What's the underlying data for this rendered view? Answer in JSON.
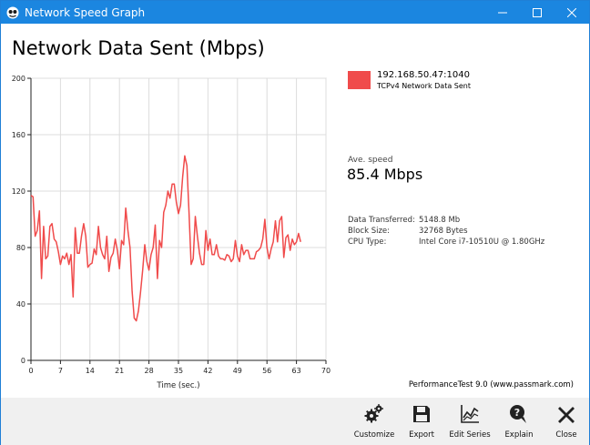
{
  "window": {
    "title": "Network Speed Graph"
  },
  "heading": "Network Data Sent (Mbps)",
  "legend": {
    "series_name": "192.168.50.47:1040",
    "description": "TCPv4 Network Data Sent",
    "color": "#f04b4b"
  },
  "average": {
    "label": "Ave. speed",
    "value": "85.4 Mbps"
  },
  "stats": [
    {
      "key": "Data Transferred:",
      "value": "5148.8 Mb"
    },
    {
      "key": "Block Size:",
      "value": "32768 Bytes"
    },
    {
      "key": "CPU Type:",
      "value": "Intel Core i7-10510U @ 1.80GHz"
    }
  ],
  "footer_note": "PerformanceTest 9.0 (www.passmark.com)",
  "toolbar": {
    "customize": "Customize",
    "export": "Export",
    "edit_series": "Edit Series",
    "explain": "Explain",
    "close": "Close"
  },
  "chart_data": {
    "type": "line",
    "xlabel": "Time (sec.)",
    "ylabel": "",
    "xlim": [
      0,
      70
    ],
    "ylim": [
      0,
      200
    ],
    "xticks": [
      0,
      7,
      14,
      21,
      28,
      35,
      42,
      49,
      56,
      63,
      70
    ],
    "yticks": [
      0,
      40,
      80,
      120,
      160,
      200
    ],
    "grid": true,
    "series": [
      {
        "name": "192.168.50.47:1040",
        "color": "#f04b4b",
        "x": [
          0,
          0.5,
          1,
          1.5,
          2,
          2.5,
          3,
          3.5,
          4,
          4.5,
          5,
          5.5,
          6,
          6.5,
          7,
          7.5,
          8,
          8.5,
          9,
          9.5,
          10,
          10.5,
          11,
          11.5,
          12,
          12.5,
          13,
          13.5,
          14,
          14.5,
          15,
          15.5,
          16,
          16.5,
          17,
          17.5,
          18,
          18.5,
          19,
          19.5,
          20,
          20.5,
          21,
          21.5,
          22,
          22.5,
          23,
          23.5,
          24,
          24.5,
          25,
          25.5,
          26,
          26.5,
          27,
          27.5,
          28,
          28.5,
          29,
          29.5,
          30,
          30.5,
          31,
          31.5,
          32,
          32.5,
          33,
          33.5,
          34,
          34.5,
          35,
          35.5,
          36,
          36.5,
          37,
          37.5,
          38,
          38.5,
          39,
          39.5,
          40,
          40.5,
          41,
          41.5,
          42,
          42.5,
          43,
          43.5,
          44,
          44.5,
          45,
          45.5,
          46,
          46.5,
          47,
          47.5,
          48,
          48.5,
          49,
          49.5,
          50,
          50.5,
          51,
          51.5,
          52,
          52.5,
          53,
          53.5,
          54,
          54.5,
          55,
          55.5,
          56,
          56.5,
          57,
          57.5,
          58,
          58.5,
          59,
          59.5,
          60,
          60.5,
          61,
          61.5,
          62,
          62.5,
          63,
          63.5,
          64
        ],
        "y": [
          117,
          116,
          88,
          92,
          106,
          58,
          95,
          72,
          74,
          95,
          97,
          86,
          84,
          77,
          68,
          74,
          72,
          76,
          68,
          75,
          45,
          94,
          76,
          76,
          88,
          97,
          88,
          66,
          68,
          69,
          79,
          75,
          95,
          80,
          75,
          72,
          88,
          63,
          73,
          76,
          86,
          78,
          65,
          85,
          82,
          108,
          92,
          80,
          49,
          30,
          28,
          35,
          48,
          64,
          82,
          70,
          64,
          75,
          80,
          96,
          58,
          85,
          80,
          105,
          110,
          120,
          115,
          125,
          125,
          112,
          104,
          110,
          130,
          145,
          138,
          105,
          68,
          72,
          102,
          88,
          76,
          68,
          68,
          92,
          78,
          86,
          75,
          75,
          82,
          74,
          72,
          72,
          71,
          75,
          74,
          70,
          72,
          85,
          74,
          70,
          82,
          75,
          78,
          78,
          72,
          72,
          72,
          77,
          78,
          80,
          86,
          100,
          80,
          72,
          79,
          84,
          99,
          84,
          99,
          102,
          73,
          87,
          89,
          78,
          86,
          82,
          84,
          90,
          84
        ]
      }
    ]
  }
}
